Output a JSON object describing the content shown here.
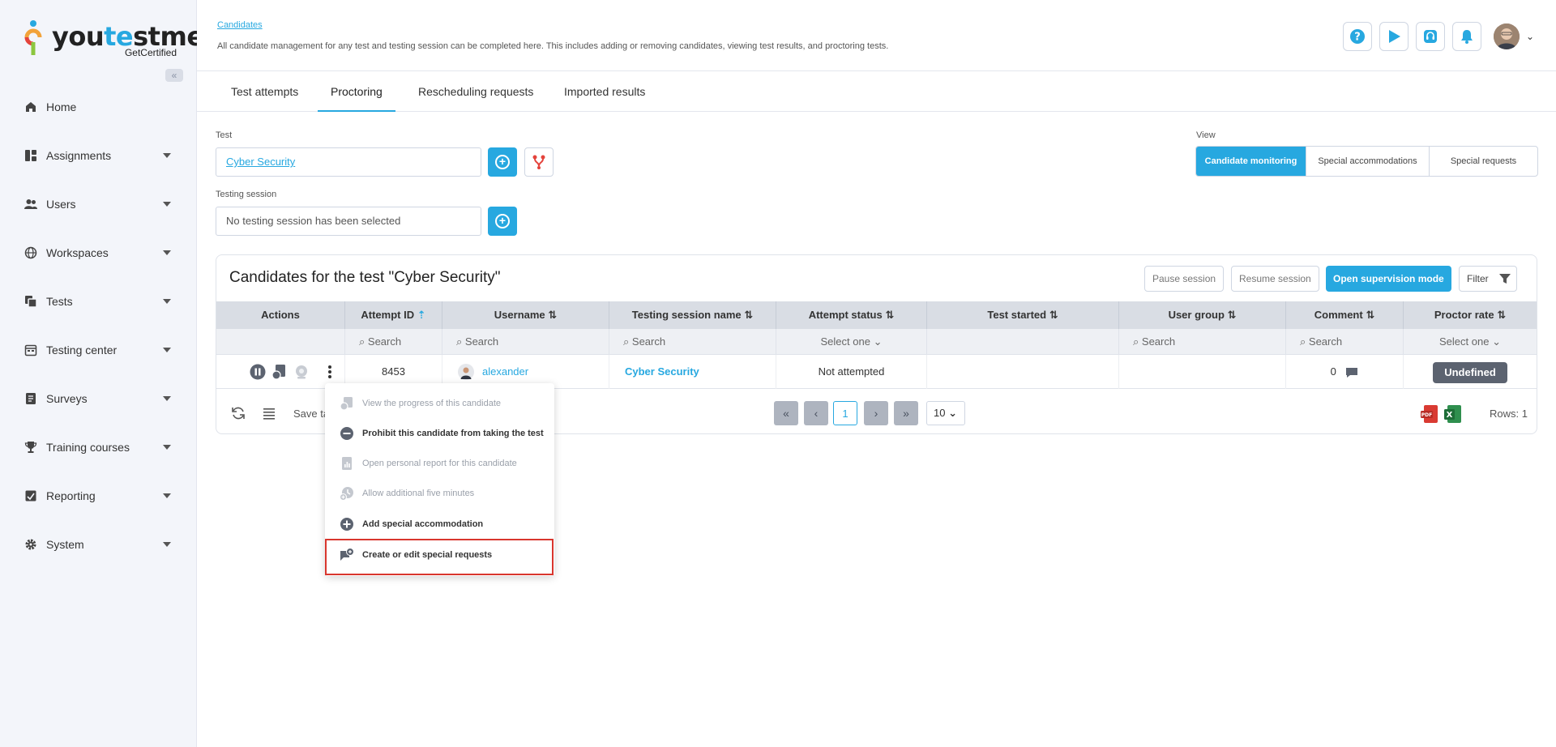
{
  "brand": {
    "name_pre": "you",
    "name_te": "te",
    "name_post": "stme",
    "tagline": "GetCertified"
  },
  "sidebar": {
    "items": [
      {
        "label": "Home",
        "icon": "home-icon",
        "has_caret": false
      },
      {
        "label": "Assignments",
        "icon": "assignments-icon",
        "has_caret": true
      },
      {
        "label": "Users",
        "icon": "users-icon",
        "has_caret": true
      },
      {
        "label": "Workspaces",
        "icon": "globe-icon",
        "has_caret": true
      },
      {
        "label": "Tests",
        "icon": "tests-icon",
        "has_caret": true
      },
      {
        "label": "Testing center",
        "icon": "calendar-icon",
        "has_caret": true
      },
      {
        "label": "Surveys",
        "icon": "surveys-icon",
        "has_caret": true
      },
      {
        "label": "Training courses",
        "icon": "trophy-icon",
        "has_caret": true
      },
      {
        "label": "Reporting",
        "icon": "reporting-icon",
        "has_caret": true
      },
      {
        "label": "System",
        "icon": "gear-icon",
        "has_caret": true
      }
    ]
  },
  "header": {
    "breadcrumb": "Candidates",
    "description": "All candidate management for any test and testing session can be completed here. This includes adding or removing candidates, viewing test results, and proctoring tests."
  },
  "tabs": [
    {
      "label": "Test attempts",
      "active": false
    },
    {
      "label": "Proctoring",
      "active": true
    },
    {
      "label": "Rescheduling requests",
      "active": false
    },
    {
      "label": "Imported results",
      "active": false
    }
  ],
  "form": {
    "test_label": "Test",
    "test_value": "Cyber Security",
    "session_label": "Testing session",
    "session_value": "No testing session has been selected",
    "view_label": "View",
    "view_options": [
      "Candidate monitoring",
      "Special accommodations",
      "Special requests"
    ]
  },
  "card": {
    "title": "Candidates for the test \"Cyber Security\"",
    "pause": "Pause session",
    "resume": "Resume session",
    "supervision": "Open supervision mode",
    "filter": "Filter"
  },
  "table": {
    "columns": [
      {
        "label": "Actions",
        "sort": ""
      },
      {
        "label": "Attempt ID",
        "sort": "asc"
      },
      {
        "label": "Username",
        "sort": "both"
      },
      {
        "label": "Testing session name",
        "sort": "both"
      },
      {
        "label": "Attempt status",
        "sort": "both"
      },
      {
        "label": "Test started",
        "sort": "both"
      },
      {
        "label": "User group",
        "sort": "both"
      },
      {
        "label": "Comment",
        "sort": "both"
      },
      {
        "label": "Proctor rate",
        "sort": "both"
      }
    ],
    "filters": {
      "search": "Search",
      "select": "Select one"
    },
    "row": {
      "attempt_id": "8453",
      "username": "alexander",
      "session": "Cyber Security",
      "status": "Not attempted",
      "comment_count": "0",
      "proctor_rate": "Undefined"
    },
    "save_label": "Save ta",
    "page": "1",
    "page_size": "10",
    "rows": "Rows: 1"
  },
  "context_menu": {
    "items": [
      {
        "label": "View the progress of this candidate",
        "enabled": false
      },
      {
        "label": "Prohibit this candidate from taking the test",
        "enabled": true
      },
      {
        "label": "Open personal report for this candidate",
        "enabled": false
      },
      {
        "label": "Allow additional five minutes",
        "enabled": false
      },
      {
        "label": "Add special accommodation",
        "enabled": true
      },
      {
        "label": "Create or edit special requests",
        "enabled": true
      }
    ]
  },
  "colors": {
    "accent": "#27a8e0",
    "highlight": "#d9362e",
    "badge": "#5c6370"
  }
}
